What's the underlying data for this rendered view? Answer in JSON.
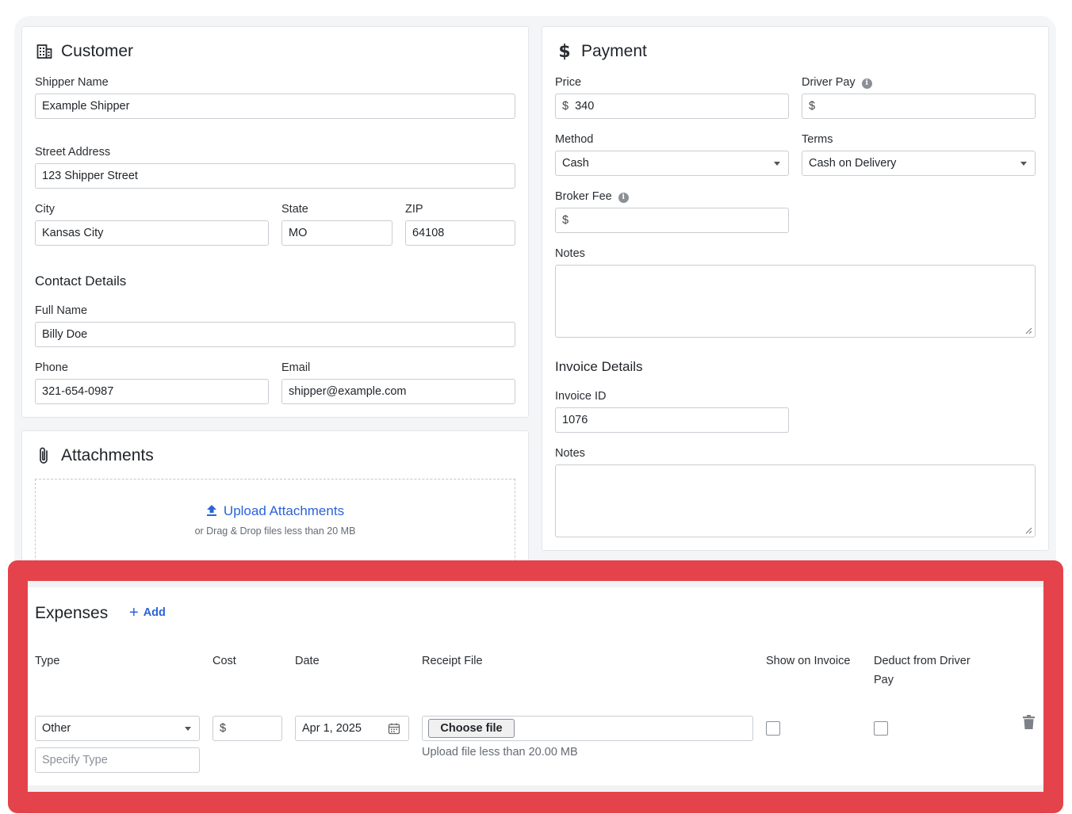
{
  "customer": {
    "title": "Customer",
    "icon": "building-icon",
    "shipper_name_label": "Shipper Name",
    "shipper_name": "Example Shipper",
    "street_label": "Street Address",
    "street": "123 Shipper Street",
    "city_label": "City",
    "city": "Kansas City",
    "state_label": "State",
    "state": "MO",
    "zip_label": "ZIP",
    "zip": "64108",
    "contact_title": "Contact Details",
    "full_name_label": "Full Name",
    "full_name": "Billy Doe",
    "phone_label": "Phone",
    "phone": "321-654-0987",
    "email_label": "Email",
    "email": "shipper@example.com"
  },
  "attachments": {
    "title": "Attachments",
    "icon": "paperclip-icon",
    "upload_label": "Upload Attachments",
    "upload_hint": "or Drag & Drop files less than 20 MB"
  },
  "payment": {
    "title": "Payment",
    "icon": "dollar-icon",
    "price_label": "Price",
    "price": "340",
    "currency_symbol": "$",
    "driver_pay_label": "Driver Pay",
    "driver_pay": "",
    "method_label": "Method",
    "method": "Cash",
    "terms_label": "Terms",
    "terms": "Cash on Delivery",
    "broker_fee_label": "Broker Fee",
    "broker_fee": "",
    "notes_label": "Notes",
    "invoice_title": "Invoice Details",
    "invoice_id_label": "Invoice ID",
    "invoice_id": "1076",
    "invoice_notes_label": "Notes"
  },
  "expenses": {
    "title": "Expenses",
    "add_label": "Add",
    "columns": {
      "type": "Type",
      "cost": "Cost",
      "date": "Date",
      "receipt": "Receipt File",
      "show_on_invoice": "Show on Invoice",
      "deduct": "Deduct from Driver Pay"
    },
    "row": {
      "type": "Other",
      "specify_placeholder": "Specify Type",
      "cost_prefix": "$",
      "date": "Apr 1, 2025",
      "choose_file": "Choose file",
      "file_hint": "Upload file less than 20.00 MB",
      "show_on_invoice": false,
      "deduct": false
    }
  },
  "colors": {
    "accent": "#2b63d9",
    "highlight": "#e4434b"
  }
}
